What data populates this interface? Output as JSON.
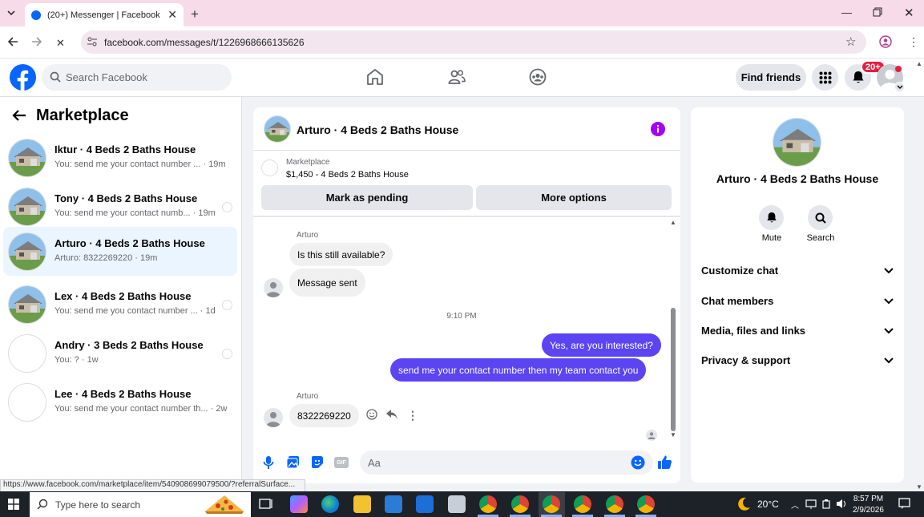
{
  "browser": {
    "tab_title": "(20+) Messenger | Facebook",
    "url": "facebook.com/messages/t/1226968666135626",
    "status_url": "https://www.facebook.com/marketplace/item/540908699079500/?referralSurface..."
  },
  "header": {
    "search_placeholder": "Search Facebook",
    "find_friends": "Find friends",
    "notification_badge": "20+"
  },
  "sidebar": {
    "title": "Marketplace",
    "conversations": [
      {
        "name": "Iktur · 4 Beds 2 Baths House",
        "snippet": "You: send me your contact number ... · 19m",
        "active": false
      },
      {
        "name": "Tony · 4 Beds 2 Baths House",
        "snippet": "You: send me your contact numb... · 19m",
        "active": false
      },
      {
        "name": "Arturo · 4 Beds 2 Baths House",
        "snippet": "Arturo: 8322269220 · 19m",
        "active": true
      },
      {
        "name": "Lex · 4 Beds 2 Baths House",
        "snippet": "You: send me you contact number ... · 1d",
        "active": false
      },
      {
        "name": "Andry · 3 Beds 2 Baths House",
        "snippet": "You: ? · 1w",
        "active": false
      },
      {
        "name": "Lee · 4 Beds 2 Baths House",
        "snippet": "You: send me your contact number th... · 2w",
        "active": false
      }
    ]
  },
  "chat": {
    "title": "Arturo · 4 Beds 2 Baths House",
    "marketplace_label": "Marketplace",
    "listing": "$1,450 - 4 Beds 2 Baths House",
    "mark_pending": "Mark as pending",
    "more_options": "More options",
    "messages": {
      "sender_1": "Arturo",
      "msg_1": "Is this still available?",
      "msg_2": "Message sent",
      "timestamp": "9:10 PM",
      "out_1": "Yes, are you interested?",
      "out_2": "send me your contact number then my team contact you",
      "sender_2": "Arturo",
      "msg_3": "8322269220"
    },
    "composer_placeholder": "Aa"
  },
  "info_panel": {
    "name": "Arturo · 4 Beds 2 Baths House",
    "mute": "Mute",
    "search": "Search",
    "sections": [
      "Customize chat",
      "Chat members",
      "Media, files and links",
      "Privacy & support"
    ]
  },
  "taskbar": {
    "search_placeholder": "Type here to search",
    "temperature": "20°C",
    "time": "8:57 PM",
    "date": "2/9/2026"
  },
  "colors": {
    "fb_blue": "#0866ff",
    "outgoing_bubble": "#5b44f2",
    "info_purple": "#a300f5"
  }
}
